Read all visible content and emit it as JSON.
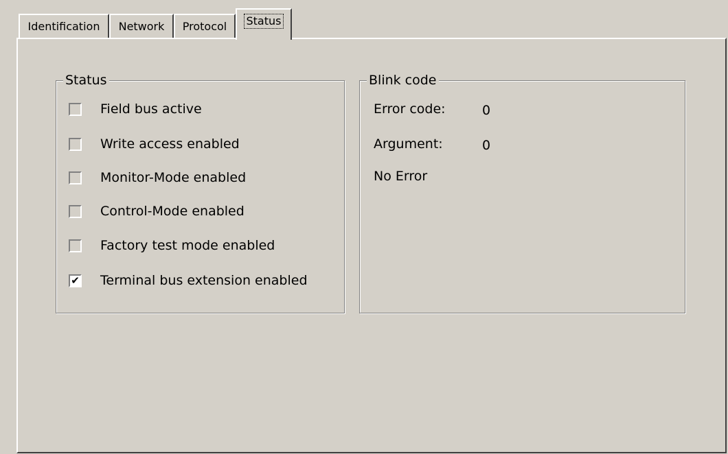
{
  "tabs": [
    {
      "label": "Identification",
      "active": false
    },
    {
      "label": "Network",
      "active": false
    },
    {
      "label": "Protocol",
      "active": false
    },
    {
      "label": "Status",
      "active": true
    }
  ],
  "status_group": {
    "title": "Status",
    "items": [
      {
        "label": "Field bus active",
        "checked": false
      },
      {
        "label": "Write access enabled",
        "checked": false
      },
      {
        "label": "Monitor-Mode enabled",
        "checked": false
      },
      {
        "label": "Control-Mode enabled",
        "checked": false
      },
      {
        "label": "Factory test mode enabled",
        "checked": false
      },
      {
        "label": "Terminal bus extension enabled",
        "checked": true
      }
    ]
  },
  "blink_group": {
    "title": "Blink code",
    "error_code_label": "Error code:",
    "error_code_value": "0",
    "argument_label": "Argument:",
    "argument_value": "0",
    "message": "No Error"
  },
  "check_glyph": "✔",
  "colors": {
    "background": "#d4d0c8",
    "highlight": "#ffffff",
    "shadow": "#808080",
    "dark_shadow": "#404040"
  }
}
